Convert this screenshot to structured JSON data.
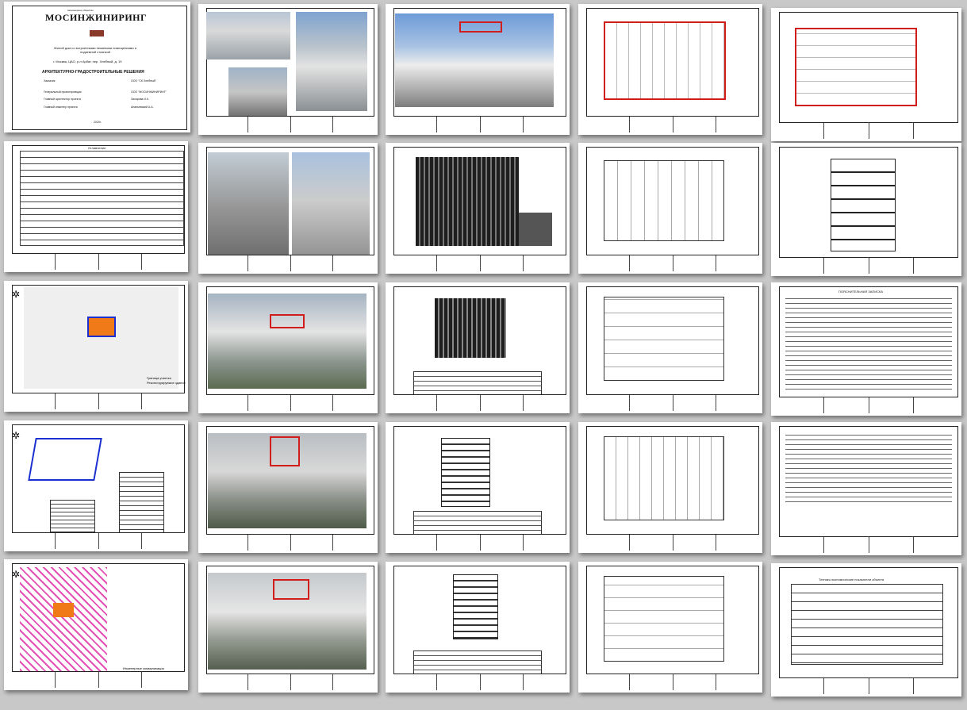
{
  "cover": {
    "company_small": "Акционерное общество",
    "company": "МОСИНЖИНИРИНГ",
    "project": "Жилой дом со встроенными нежилыми помещениями и подземной стоянкой",
    "address": "г. Москва, ЦАО, р-н Арбат, пер. Хлебный, д. 19",
    "section": "АРХИТЕКТУРНО-ГРАДОСТРОИТЕЛЬНЫЕ РЕШЕНИЯ",
    "rows": [
      {
        "label": "Заказчик",
        "value": "ООО \"СК Хлебный\""
      },
      {
        "label": "Генеральный проектировщик",
        "value": "ООО \"МОСИНЖИНИРИНГ\""
      },
      {
        "label": "Главный архитектор проекта",
        "value": "Захарова И.К."
      },
      {
        "label": "Главный инженер проекта",
        "value": "Ананьевский А.А."
      }
    ],
    "year": "2020г."
  },
  "contents_title": "Оглавление",
  "explanatory_title": "ПОЯСНИТЕЛЬНАЯ ЗАПИСКА",
  "teap_title": "Технико-экономические показатели объекта",
  "legend_outline": "Контур надстройки/реконструкции",
  "legend_site": "Граница участка",
  "legend_reconstruction": "Реконструируемое здание",
  "legend_engineering": "Инженерные коммуникации"
}
